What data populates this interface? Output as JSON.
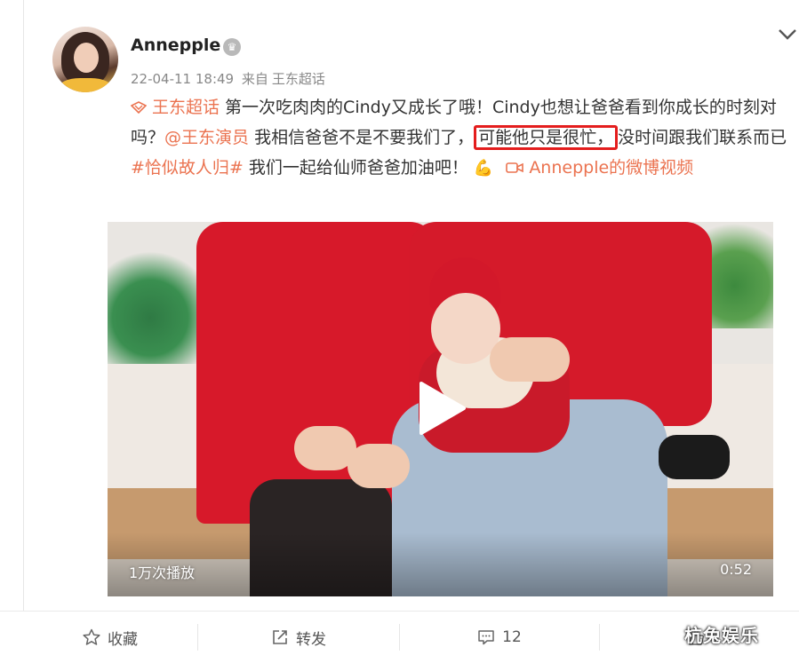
{
  "post": {
    "author": "Annepple",
    "timestamp": "22-04-11 18:49",
    "source_prefix": "来自",
    "source": "王东超话",
    "text": {
      "topic": "王东超话",
      "part1": " 第一次吃肉肉的Cindy又成长了哦！Cindy也想让爸爸看到你成长的时刻对吗？",
      "mention": "@王东演员",
      "part2": " 我相信爸爸不是不要我们了，",
      "highlight": "可能他只是很忙，",
      "part3": "没时间跟我们联系而已",
      "hashtag": "#恰似故人归#",
      "part4": " 我们一起给仙师爸爸加油吧！",
      "emoji": "💪",
      "video_link": "Annepple的微博视频"
    },
    "video": {
      "views": "1万次播放",
      "duration": "0:52"
    }
  },
  "footer": {
    "favorite": "收藏",
    "repost": "转发",
    "comments": "12"
  },
  "watermark": "杭兔娱乐",
  "colors": {
    "link": "#eb7350",
    "highlight_border": "#e41d1d"
  }
}
